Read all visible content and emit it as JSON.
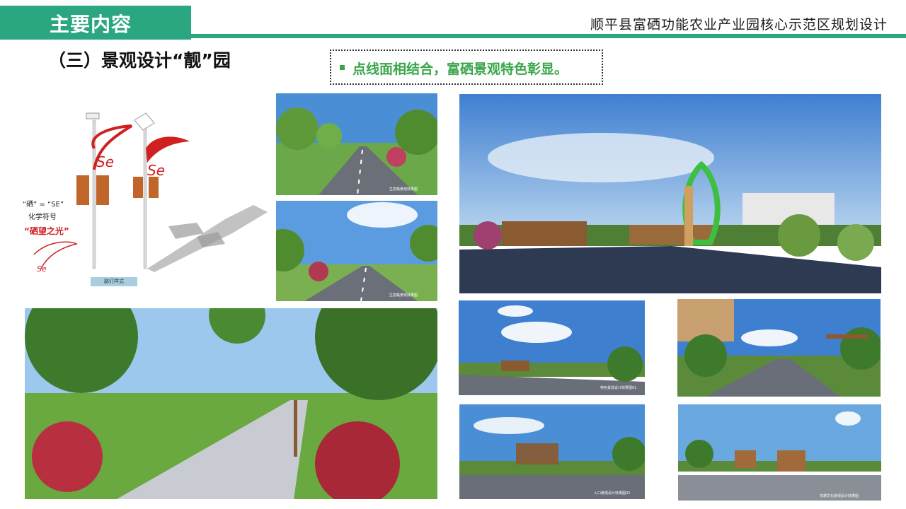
{
  "header": {
    "tab_title": "主要内容",
    "subtitle": "顺平县富硒功能农业产业园核心示范区规划设计"
  },
  "section": {
    "title": "（三）景观设计“靓”园"
  },
  "callout": {
    "text": "点线面相结合，富硒景观特色彰显。"
  },
  "lamp_panel": {
    "line1": "“硒” = “SE”",
    "line2": "化学符号",
    "line3": "“硒望之光”",
    "label": "路灯样式"
  },
  "captions": {
    "road1": "生态路景观效果图",
    "road2": "生态路景观效果图",
    "entrance": "",
    "path": "",
    "park1": "特色景观设计效果图01",
    "walk1": "",
    "park2": "入口景观设计效果图02",
    "park3": "农耕文化景观设计效果图"
  },
  "colors": {
    "accent": "#2aa680",
    "callout_green": "#3aa64a",
    "lamp_red": "#d02020"
  }
}
